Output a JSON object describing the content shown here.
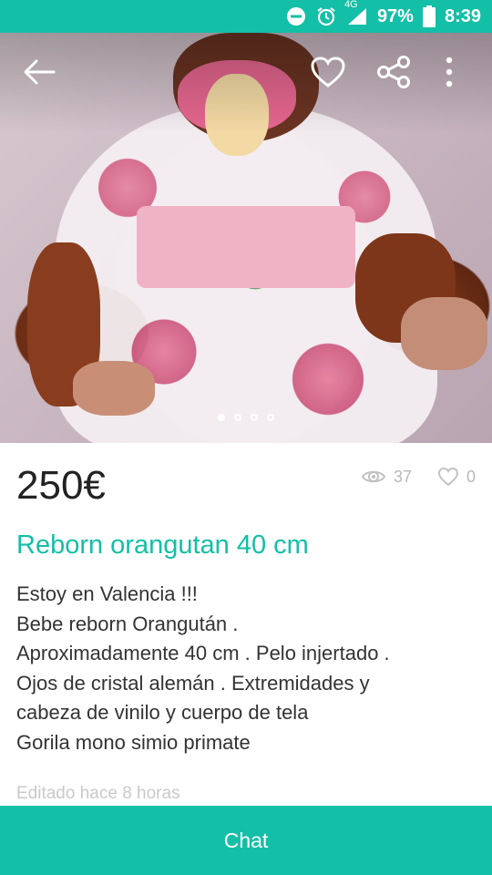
{
  "status_bar": {
    "icons": [
      "minus-circle-icon",
      "alarm-icon",
      "network-4g-icon",
      "signal-icon",
      "battery-icon"
    ],
    "network_label": "4G",
    "battery": "97%",
    "time": "8:39"
  },
  "photo": {
    "toolbar_icons": [
      "back-arrow-icon",
      "heart-icon",
      "share-icon",
      "more-vert-icon"
    ],
    "pager": {
      "count": 4,
      "active_index": 0
    }
  },
  "listing": {
    "price": "250€",
    "views": "37",
    "likes": "0",
    "title": "Reborn orangutan 40 cm",
    "description_lines": [
      "Estoy en Valencia !!!",
      "Bebe reborn Orangután .",
      "Aproximadamente 40 cm . Pelo injertado .",
      "Ojos de cristal alemán . Extremidades y",
      "cabeza de vinilo y cuerpo de tela",
      "Gorila mono simio primate"
    ],
    "edited": "Editado hace 8 horas"
  },
  "chat_button": {
    "label": "Chat"
  },
  "colors": {
    "accent": "#13bfa6",
    "text": "#333333",
    "muted": "#b8b8b8"
  }
}
